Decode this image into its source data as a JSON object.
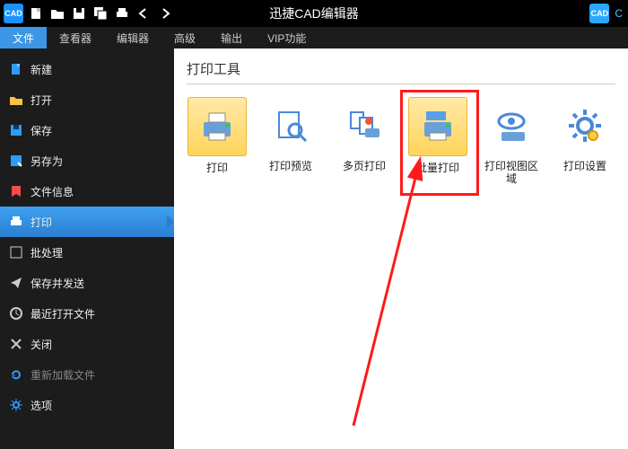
{
  "titlebar": {
    "title": "迅捷CAD编辑器",
    "logo_text": "CAD",
    "right_logo_text": "CAD",
    "right_letter": "C"
  },
  "menu": {
    "tabs": [
      {
        "label": "文件",
        "active": true
      },
      {
        "label": "查看器"
      },
      {
        "label": "编辑器"
      },
      {
        "label": "高级"
      },
      {
        "label": "输出"
      },
      {
        "label": "VIP功能"
      }
    ]
  },
  "sidebar": {
    "items": [
      {
        "label": "新建",
        "icon": "file-new",
        "color": "#2e9bff"
      },
      {
        "label": "打开",
        "icon": "folder-open",
        "color": "#f5c242"
      },
      {
        "label": "保存",
        "icon": "save",
        "color": "#2e9bff"
      },
      {
        "label": "另存为",
        "icon": "save-as",
        "color": "#2e9bff"
      },
      {
        "label": "文件信息",
        "icon": "info",
        "color": "#ff4a4a"
      },
      {
        "label": "打印",
        "icon": "print",
        "selected": true,
        "color": "#ffffff"
      },
      {
        "label": "批处理",
        "icon": "batch",
        "color": "#cccccc"
      },
      {
        "label": "保存并发送",
        "icon": "send",
        "color": "#cccccc"
      },
      {
        "label": "最近打开文件",
        "icon": "recent",
        "color": "#cccccc"
      },
      {
        "label": "关闭",
        "icon": "close",
        "color": "#cccccc"
      },
      {
        "label": "重新加载文件",
        "icon": "reload",
        "dim": true,
        "color": "#2e9bff"
      },
      {
        "label": "选项",
        "icon": "gear",
        "color": "#2e9bff"
      }
    ]
  },
  "content": {
    "panel_title": "打印工具",
    "tools": [
      {
        "label": "打印",
        "icon": "printer",
        "variant": "primary"
      },
      {
        "label": "打印预览",
        "icon": "preview"
      },
      {
        "label": "多页打印",
        "icon": "multipage"
      },
      {
        "label": "批量打印",
        "icon": "batch-printer",
        "variant": "primary",
        "highlighted": true
      },
      {
        "label": "打印视图区域",
        "icon": "view-area"
      },
      {
        "label": "打印设置",
        "icon": "settings-gear"
      }
    ]
  },
  "annotation": {
    "arrow_color": "#ff1a1a"
  }
}
